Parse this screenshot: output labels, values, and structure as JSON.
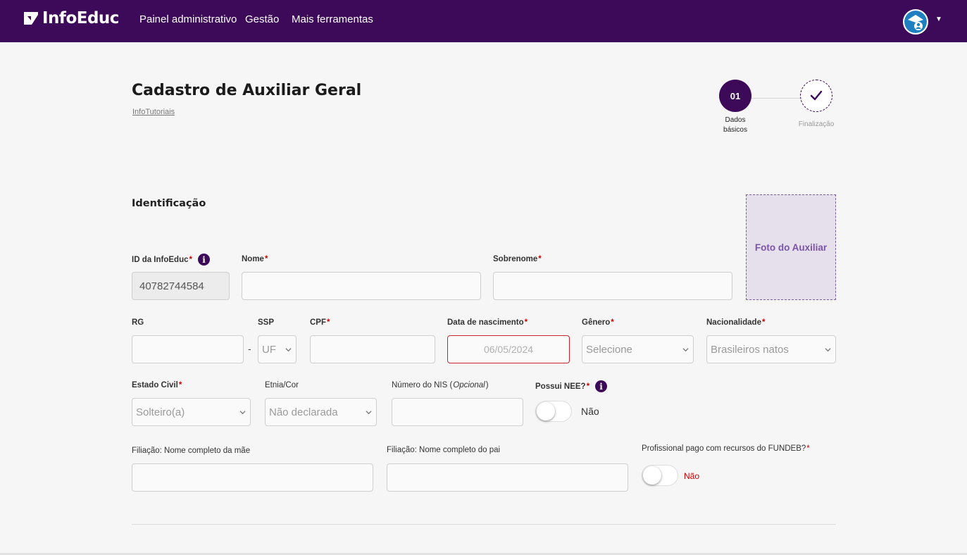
{
  "app": {
    "logo_text": "InfoEduc",
    "nav": [
      "Painel administrativo",
      "Gestão",
      "Mais ferramentas"
    ]
  },
  "page": {
    "title": "Cadastro de Auxiliar Geral",
    "breadcrumb": "InfoTutoriais"
  },
  "stepper": {
    "steps": [
      {
        "number": "01",
        "label_line1": "Dados",
        "label_line2": "básicos",
        "state": "active"
      },
      {
        "number": "",
        "label_line1": "Finalização",
        "label_line2": "",
        "state": "pending"
      }
    ]
  },
  "section": {
    "title": "Identificação"
  },
  "photo": {
    "label": "Foto do Auxiliar"
  },
  "fields": {
    "id_infoeduc": {
      "label": "ID da InfoEduc",
      "value": "40782744584",
      "required": true
    },
    "nome": {
      "label": "Nome",
      "value": "",
      "required": true
    },
    "sobrenome": {
      "label": "Sobrenome",
      "value": "",
      "required": true
    },
    "rg": {
      "label": "RG",
      "value": ""
    },
    "ssp": {
      "label": "SSP",
      "value": "UF"
    },
    "cpf": {
      "label": "CPF",
      "value": "",
      "required": true
    },
    "data_nascimento": {
      "label": "Data de nascimento",
      "placeholder": "06/05/2024",
      "required": true
    },
    "genero": {
      "label": "Gênero",
      "value": "Selecione",
      "required": true
    },
    "nacionalidade": {
      "label": "Nacionalidade",
      "value": "Brasileiros natos",
      "required": true
    },
    "estado_civil": {
      "label": "Estado Civil",
      "value": "Solteiro(a)",
      "required": true
    },
    "etnia": {
      "label": "Etnia/Cor",
      "value": "Não declarada"
    },
    "nis": {
      "label": "Número do NIS",
      "optional_note": "Opcional",
      "value": ""
    },
    "nee": {
      "label": "Possui NEE?",
      "state_text": "Não",
      "checked": false,
      "required": true
    },
    "mae": {
      "label": "Filiação: Nome completo da mãe",
      "value": ""
    },
    "pai": {
      "label": "Filiação: Nome completo do pai",
      "value": ""
    },
    "fundeb": {
      "label": "Profissional pago com recursos do FUNDEB?",
      "state_text": "Não",
      "checked": false,
      "required": true
    }
  },
  "required_marker": "*",
  "colors": {
    "brand": "#3d0a59",
    "required": "#d40000",
    "invalid_border": "#c9252c",
    "photo_bg": "#e5e0ec",
    "photo_text": "#7c54a8"
  },
  "icons": {
    "info": "info-icon",
    "chevron": "chevron-down-icon",
    "check": "check-icon",
    "avatar": "user-avatar",
    "caret": "caret-down-icon"
  }
}
